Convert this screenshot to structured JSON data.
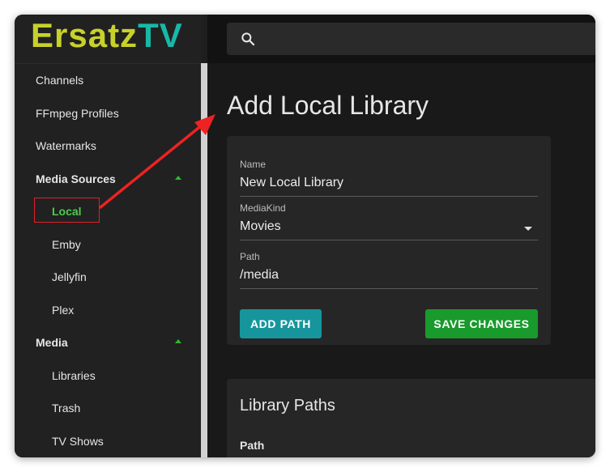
{
  "app": {
    "logo_part1": "Ersatz",
    "logo_part2": "TV"
  },
  "search": {
    "icon": "search-icon",
    "placeholder": ""
  },
  "sidebar": {
    "channels": "Channels",
    "ffmpeg_profiles": "FFmpeg Profiles",
    "watermarks": "Watermarks",
    "media_sources": "Media Sources",
    "media_sources_items": {
      "local": "Local",
      "emby": "Emby",
      "jellyfin": "Jellyfin",
      "plex": "Plex"
    },
    "media": "Media",
    "media_items": {
      "libraries": "Libraries",
      "trash": "Trash",
      "tv_shows": "TV Shows"
    }
  },
  "main": {
    "page_title": "Add Local Library",
    "form": {
      "name_label": "Name",
      "name_value": "New Local Library",
      "mediakind_label": "MediaKind",
      "mediakind_value": "Movies",
      "path_label": "Path",
      "path_value": "/media",
      "add_path_button": "ADD PATH",
      "save_button": "SAVE CHANGES"
    },
    "library_paths": {
      "title": "Library Paths",
      "column_path": "Path"
    }
  },
  "colors": {
    "logo_part1": "#c8d12a",
    "logo_part2": "#18b8a8",
    "add_path_button": "#16969c",
    "save_button": "#199a2c",
    "active_item": "#4ccb4c",
    "annotation": "#e0202a"
  }
}
